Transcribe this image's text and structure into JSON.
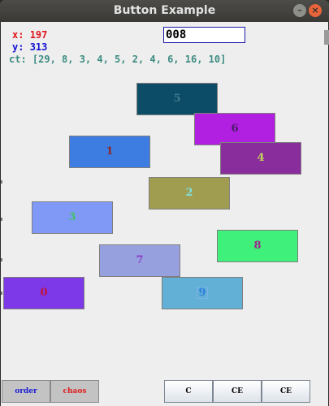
{
  "window": {
    "title": "Button Example"
  },
  "window_controls": {
    "minimize": "–",
    "close": "×"
  },
  "readout": {
    "x_label": "x:",
    "x_value": "197",
    "y_label": "y:",
    "y_value": "313",
    "ct_text": "ct: [29, 8, 3, 4, 5, 2, 4, 6, 16, 10]"
  },
  "counter": {
    "value": "008"
  },
  "blocks": [
    {
      "label": "5",
      "bg": "#0d4c66",
      "fg": "#3e7a8c"
    },
    {
      "label": "6",
      "bg": "#b11fe0",
      "fg": "#4a1b6a"
    },
    {
      "label": "1",
      "bg": "#3d7de1",
      "fg": "#8b2a2a"
    },
    {
      "label": "4",
      "bg": "#8a2d9c",
      "fg": "#c3d45a"
    },
    {
      "label": "2",
      "bg": "#a09c50",
      "fg": "#7ee2e2"
    },
    {
      "label": "3",
      "bg": "#8199f6",
      "fg": "#44c06a"
    },
    {
      "label": "8",
      "bg": "#3ff07a",
      "fg": "#a02090"
    },
    {
      "label": "7",
      "bg": "#97a0df",
      "fg": "#8a3fc8"
    },
    {
      "label": "0",
      "bg": "#7d38e8",
      "fg": "#c0123a"
    },
    {
      "label": "9",
      "bg": "#63b0d6",
      "fg": "#2c7fe0"
    }
  ],
  "buttons": {
    "order": {
      "label": "order",
      "color": "#1a1ad6"
    },
    "chaos": {
      "label": "chaos",
      "color": "#e01a1a"
    },
    "c": "C",
    "ce1": "CE",
    "ce2": "CE"
  }
}
